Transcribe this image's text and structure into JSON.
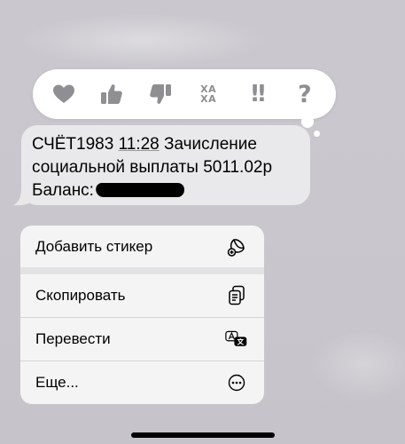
{
  "tapback_bar": {
    "reactions": [
      {
        "name": "heart-icon"
      },
      {
        "name": "thumbs-up-icon"
      },
      {
        "name": "thumbs-down-icon"
      },
      {
        "name": "haha-icon",
        "line1": "ХА",
        "line2": "ХА"
      },
      {
        "name": "exclamation-icon",
        "label": "!!"
      },
      {
        "name": "question-icon",
        "label": "?"
      }
    ],
    "icon_color": "#8e8e93"
  },
  "message": {
    "line1_prefix": "СЧЁТ1983 ",
    "time": "11:28",
    "line1_suffix": " Зачисление",
    "line2": "социальной выплаты 5011.02р",
    "line3_prefix": "Баланс:",
    "redacted": true,
    "bubble_color": "#e9e9eb"
  },
  "context_menu": {
    "items": [
      {
        "label": "Добавить стикер",
        "icon": "sticker-icon"
      },
      {
        "label": "Скопировать",
        "icon": "copy-icon"
      },
      {
        "label": "Перевести",
        "icon": "translate-icon"
      },
      {
        "label": "Еще...",
        "icon": "more-icon"
      }
    ]
  }
}
